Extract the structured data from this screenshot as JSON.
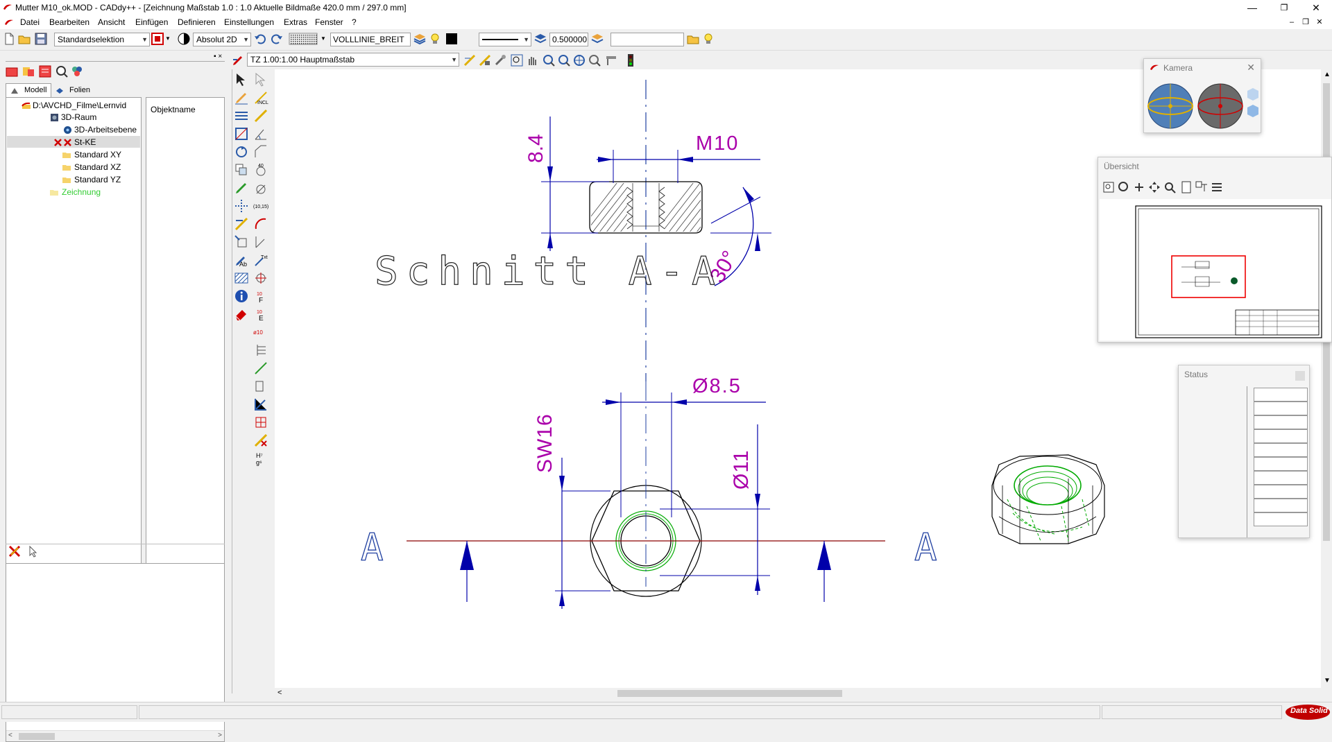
{
  "window": {
    "title": "Mutter M10_ok.MOD  -  CADdy++ - [Zeichnung   Maßstab 1.0 : 1.0   Aktuelle Bildmaße 420.0 mm / 297.0 mm]",
    "minimize": "—",
    "maximize": "❐",
    "close": "✕"
  },
  "menu": {
    "items": [
      "Datei",
      "Bearbeiten",
      "Ansicht",
      "Einfügen",
      "Definieren",
      "Einstellungen",
      "Extras",
      "Fenster",
      "?"
    ],
    "mdi_minimize": "–",
    "mdi_restore": "❐",
    "mdi_close": "✕"
  },
  "toolbar": {
    "selection_mode": "Standardselektion",
    "coord_mode": "Absolut 2D",
    "line_type": "VOLLLINIE_BREIT",
    "line_width": "0.500000",
    "search_value": ""
  },
  "toolbar2": {
    "drawing_layer": "TZ 1.00:1.00 Hauptmaßstab"
  },
  "left_panel": {
    "pin": "▪ ×",
    "tabs": [
      "Modell",
      "Folien"
    ],
    "tree": [
      {
        "label": "D:\\AVCHD_Filme\\Lernvid",
        "level": 0,
        "icon": "model-file-icon"
      },
      {
        "label": "3D-Raum",
        "level": 1,
        "icon": "3d-space-icon"
      },
      {
        "label": "3D-Arbeitsebene",
        "level": 2,
        "icon": "workplane-icon"
      },
      {
        "label": "St-KE",
        "level": 1,
        "icon": "red-cross-icon",
        "selected": true
      },
      {
        "label": "Standard XY",
        "level": 2,
        "icon": "folder-icon"
      },
      {
        "label": "Standard XZ",
        "level": 2,
        "icon": "folder-icon"
      },
      {
        "label": "Standard YZ",
        "level": 2,
        "icon": "folder-icon"
      },
      {
        "label": "Zeichnung",
        "level": 1,
        "icon": "folder-open-icon",
        "color": "#33cc33"
      }
    ],
    "object_column_header": "Objektname"
  },
  "drawing": {
    "section_label": "Schnitt A-A",
    "dim_height": "8.4",
    "dim_thread": "M10",
    "dim_angle": "30°",
    "dim_width_across_flats": "SW16",
    "dim_bore": "Ø8.5",
    "dim_outer": "Ø11",
    "cut_label_left": "A",
    "cut_label_right": "A",
    "colors": {
      "dimension": "#aa00aa",
      "dim_line": "#0000aa",
      "geometry": "#000000",
      "thread_3d": "#00aa00",
      "cut_line": "#8b0000"
    }
  },
  "kamera": {
    "title": "Kamera"
  },
  "uebersicht": {
    "title": "Übersicht"
  },
  "status_panel": {
    "title": "Status"
  },
  "statusbar": {
    "brand": "Data Solid"
  }
}
